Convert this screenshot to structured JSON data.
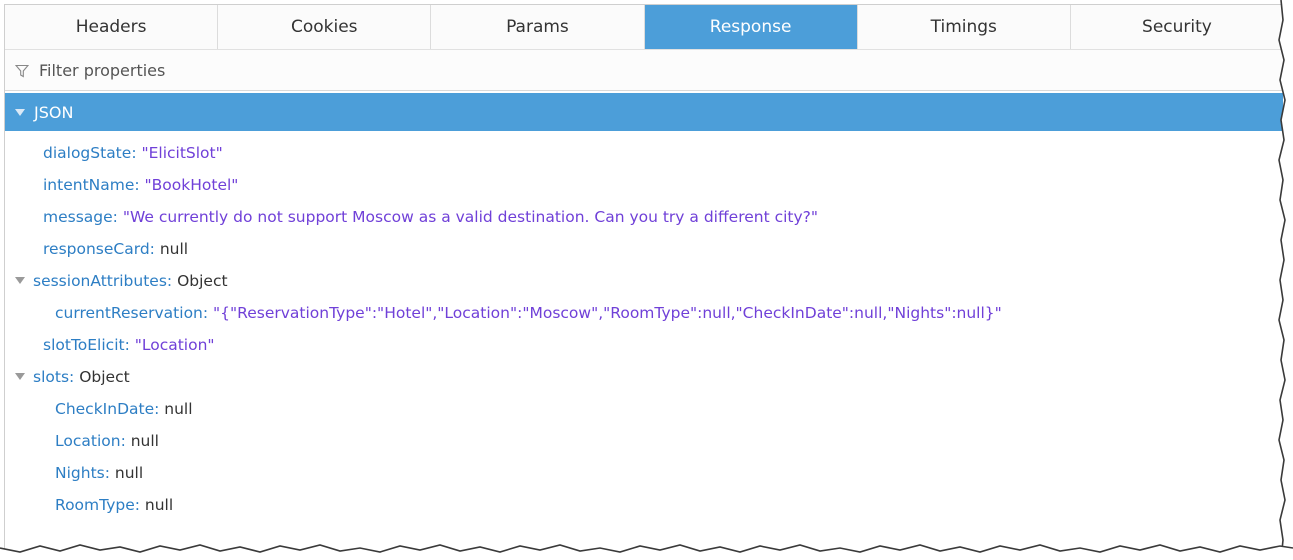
{
  "tabs": [
    {
      "label": "Headers",
      "active": false
    },
    {
      "label": "Cookies",
      "active": false
    },
    {
      "label": "Params",
      "active": false
    },
    {
      "label": "Response",
      "active": true
    },
    {
      "label": "Timings",
      "active": false
    },
    {
      "label": "Security",
      "active": false
    }
  ],
  "filter": {
    "placeholder": "Filter properties",
    "icon": "filter-icon"
  },
  "json_section": {
    "label": "JSON"
  },
  "tree": {
    "dialogState": {
      "key": "dialogState",
      "value": "\"ElicitSlot\""
    },
    "intentName": {
      "key": "intentName",
      "value": "\"BookHotel\""
    },
    "message": {
      "key": "message",
      "value": "\"We currently do not support Moscow as a valid destination.  Can you try a different city?\""
    },
    "responseCard": {
      "key": "responseCard",
      "value": "null"
    },
    "sessionAttributes": {
      "key": "sessionAttributes",
      "value": "Object",
      "children": {
        "currentReservation": {
          "key": "currentReservation",
          "value": "\"{\"ReservationType\":\"Hotel\",\"Location\":\"Moscow\",\"RoomType\":null,\"CheckInDate\":null,\"Nights\":null}\""
        }
      }
    },
    "slotToElicit": {
      "key": "slotToElicit",
      "value": "\"Location\""
    },
    "slots": {
      "key": "slots",
      "value": "Object",
      "children": {
        "CheckInDate": {
          "key": "CheckInDate",
          "value": "null"
        },
        "Location": {
          "key": "Location",
          "value": "null"
        },
        "Nights": {
          "key": "Nights",
          "value": "null"
        },
        "RoomType": {
          "key": "RoomType",
          "value": "null"
        }
      }
    }
  },
  "colors": {
    "accent": "#4c9ed9",
    "key": "#2d7ec4",
    "string": "#7040d8",
    "plain": "#333333"
  }
}
